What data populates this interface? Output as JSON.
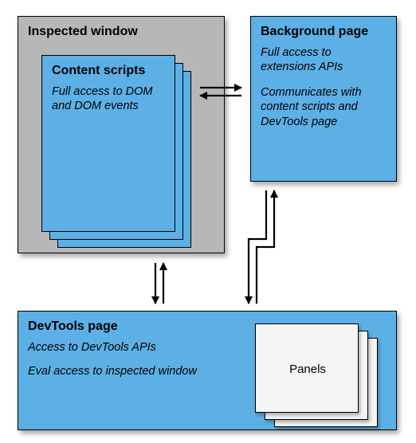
{
  "inspected_window": {
    "title": "Inspected window"
  },
  "content_scripts": {
    "title": "Content scripts",
    "desc": "Full access to DOM and DOM events"
  },
  "background_page": {
    "title": "Background page",
    "desc1": "Full access to extensions APIs",
    "desc2": "Communicates with content scripts and DevTools page"
  },
  "devtools_page": {
    "title": "DevTools page",
    "desc1": "Access to DevTools APIs",
    "desc2": "Eval access to inspected window"
  },
  "panels_label": "Panels"
}
